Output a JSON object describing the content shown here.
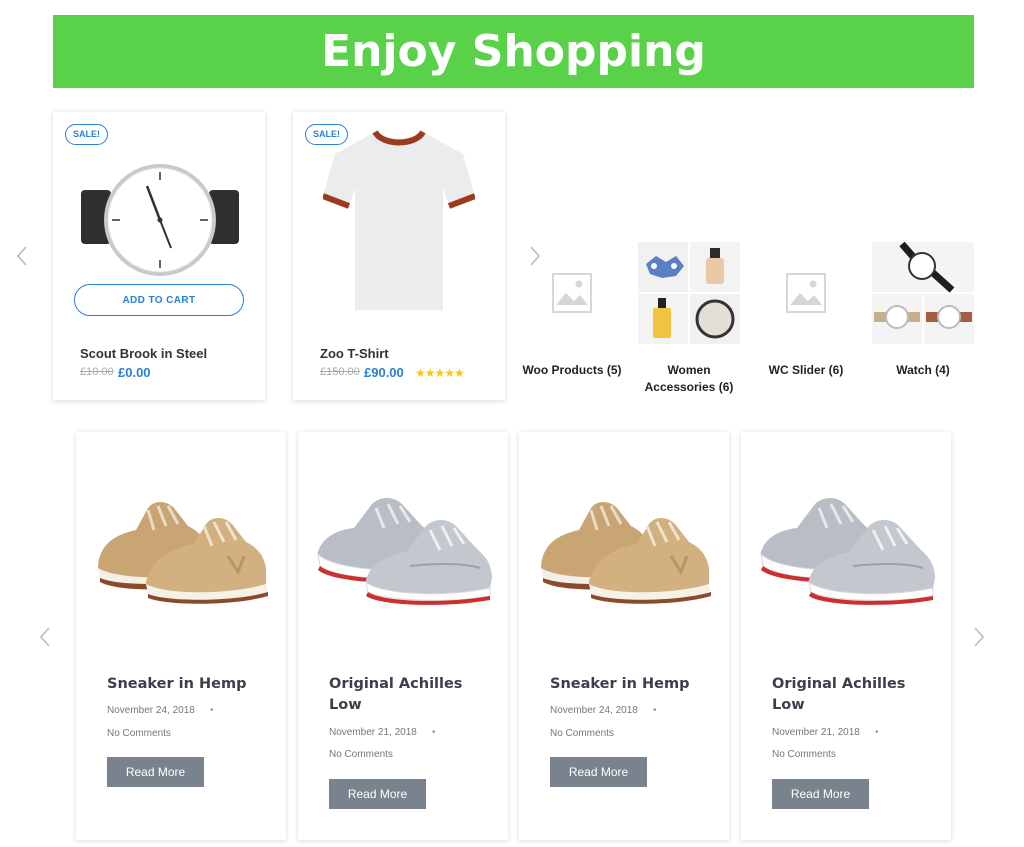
{
  "banner": {
    "title": "Enjoy Shopping",
    "color": "#59d24a"
  },
  "products": [
    {
      "badge": "SALE!",
      "button": "ADD TO CART",
      "title": "Scout Brook in Steel",
      "old_price": "£10.00",
      "new_price": "£0.00",
      "image": "watch-image"
    },
    {
      "badge": "SALE!",
      "title": "Zoo T-Shirt",
      "old_price": "£150.00",
      "new_price": "£90.00",
      "stars": "★★★★★",
      "rating": 5,
      "image": "tshirt-image"
    }
  ],
  "categories": [
    {
      "label_1": "Woo Products (5)",
      "label_2": ""
    },
    {
      "label_1": "Women",
      "label_2": "Accessories (6)"
    },
    {
      "label_1": "WC Slider (6)",
      "label_2": ""
    },
    {
      "label_1": "Watch (4)",
      "label_2": ""
    }
  ],
  "posts": [
    {
      "title_1": "Sneaker in Hemp",
      "title_2": "",
      "date": "November 24, 2018",
      "comments": "No Comments",
      "button": "Read More",
      "shoe": "tan-sneaker"
    },
    {
      "title_1": "Original Achilles",
      "title_2": "Low",
      "date": "November 21, 2018",
      "comments": "No Comments",
      "button": "Read More",
      "shoe": "grey-sneaker"
    },
    {
      "title_1": "Sneaker in Hemp",
      "title_2": "",
      "date": "November 24, 2018",
      "comments": "No Comments",
      "button": "Read More",
      "shoe": "tan-sneaker"
    },
    {
      "title_1": "Original Achilles",
      "title_2": "Low",
      "date": "November 21, 2018",
      "comments": "No Comments",
      "button": "Read More",
      "shoe": "grey-sneaker"
    }
  ],
  "colors": {
    "accent": "#2a7fd6",
    "button_grey": "#7a828d",
    "star": "#f5c518"
  }
}
